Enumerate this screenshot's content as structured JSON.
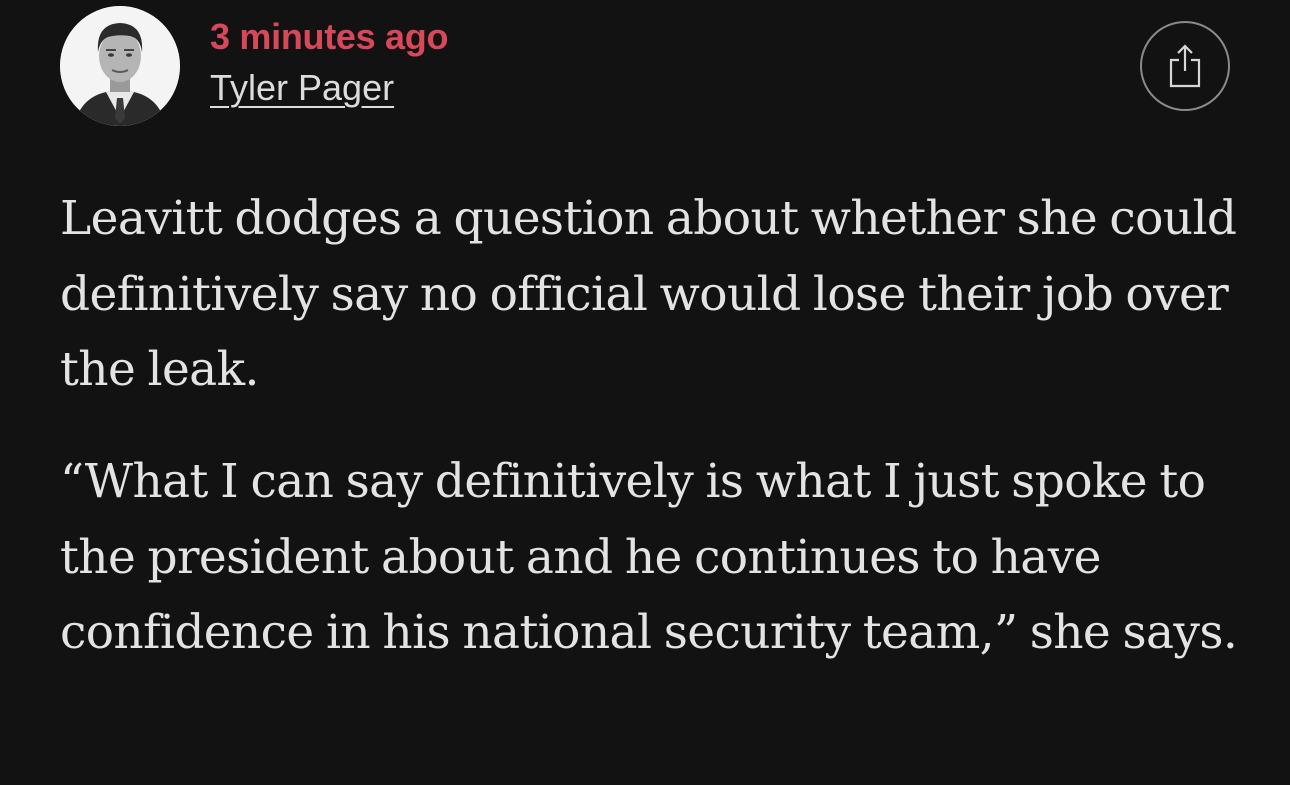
{
  "post": {
    "timestamp": "3 minutes ago",
    "author": "Tyler Pager",
    "share_icon": "share-icon",
    "avatar_icon": "author-photo",
    "colors": {
      "background": "#121212",
      "timestamp": "#d7485a",
      "text": "#e3e3e3"
    },
    "paragraphs": [
      "Leavitt dodges a question about whether she could definitively say no official would lose their job over the leak.",
      "“What I can say definitively is what I just spoke to the president about and he continues to have confidence in his national security team,” she says."
    ]
  }
}
